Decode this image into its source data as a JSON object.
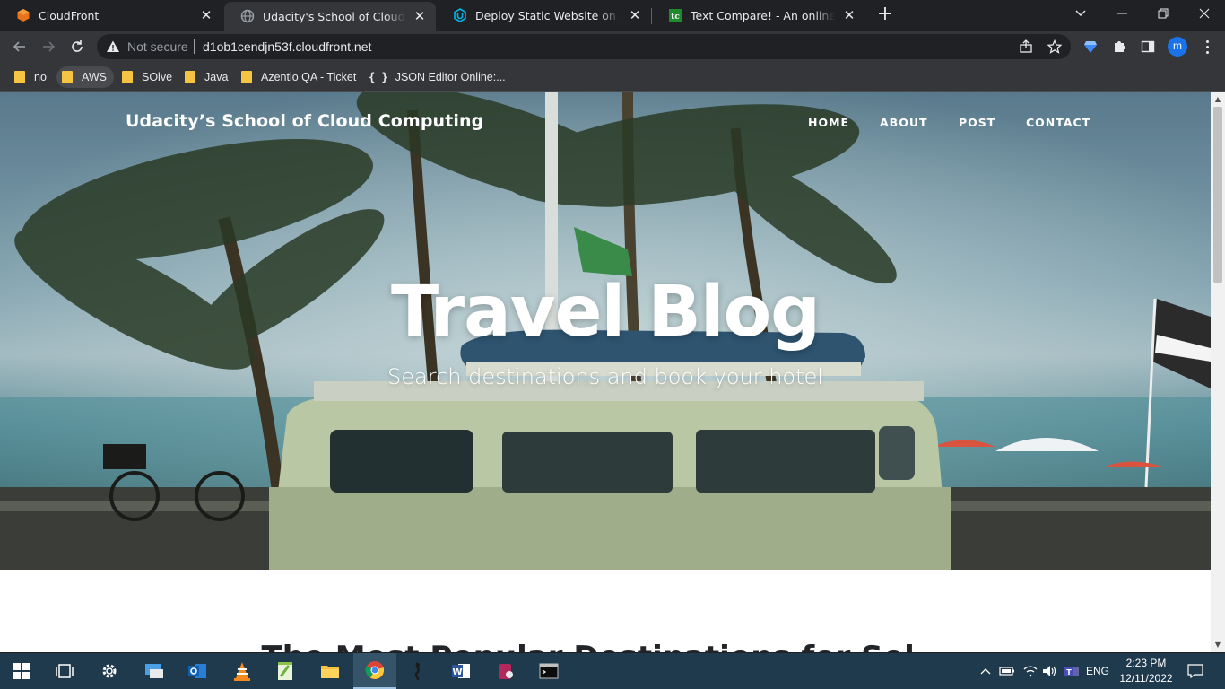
{
  "browser": {
    "tabs": [
      {
        "title": "CloudFront",
        "icon": "aws-cloudfront-icon",
        "active": false
      },
      {
        "title": "Udacity's School of Cloud Computing",
        "icon": "globe-icon",
        "active": true
      },
      {
        "title": "Deploy Static Website on AWS",
        "icon": "udacity-icon",
        "active": false
      },
      {
        "title": "Text Compare! - An online diff tool",
        "icon": "textcompare-icon",
        "active": false
      }
    ],
    "address": {
      "security_label": "Not secure",
      "url": "d1ob1cendjn53f.cloudfront.net"
    },
    "profile_initial": "m",
    "bookmarks": [
      {
        "label": "no",
        "type": "folder"
      },
      {
        "label": "AWS",
        "type": "folder"
      },
      {
        "label": "SOlve",
        "type": "folder"
      },
      {
        "label": "Java",
        "type": "folder"
      },
      {
        "label": "Azentio QA - Ticket",
        "type": "folder"
      },
      {
        "label": "JSON Editor Online:...",
        "type": "json"
      }
    ]
  },
  "site": {
    "brand": "Udacity’s School of Cloud Computing",
    "nav": [
      "HOME",
      "ABOUT",
      "POST",
      "CONTACT"
    ],
    "hero_title": "Travel Blog",
    "hero_subtitle": "Search destinations and book your hotel",
    "section_heading": "The Most Popular Destinations for Sol..."
  },
  "taskbar": {
    "apps": [
      "windows-start-icon",
      "task-view-icon",
      "settings-icon",
      "remote-desktop-icon",
      "outlook-icon",
      "vlc-icon",
      "notepad-plus-icon",
      "file-explorer-icon",
      "chrome-icon",
      "app-icon",
      "word-icon",
      "database-icon",
      "terminal-icon"
    ],
    "language": "ENG",
    "time": "2:23 PM",
    "date": "12/11/2022"
  },
  "colors": {
    "browser_bg": "#202124",
    "toolbar_bg": "#35363a",
    "taskbar_bg": "#1f3a4d",
    "hero_text": "#ffffff"
  }
}
